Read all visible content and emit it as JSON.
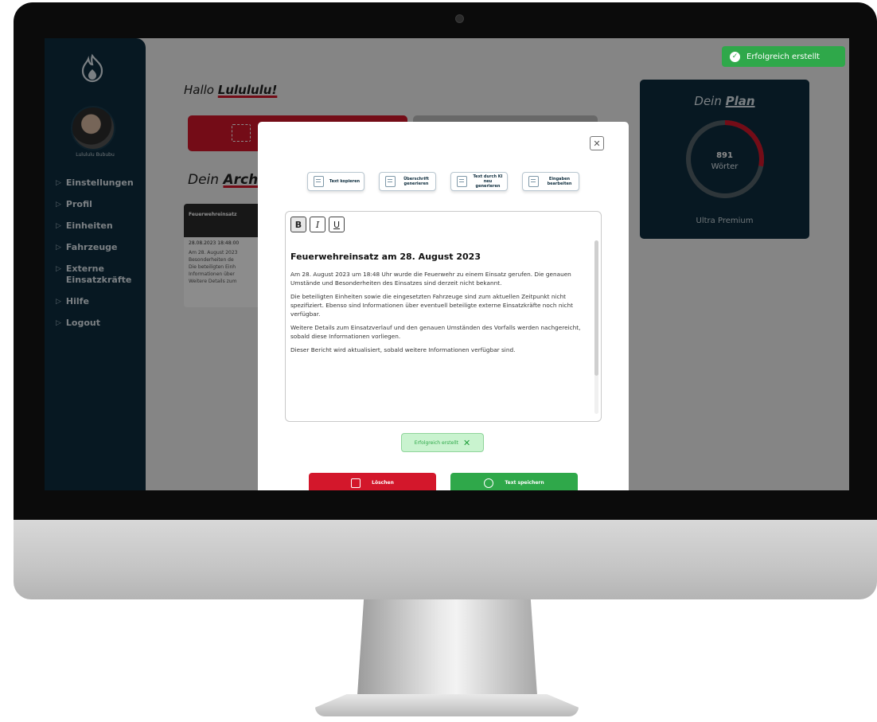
{
  "screen": {
    "greeting_prefix": "Hallo ",
    "greeting_name": "Lulululu!",
    "archive_prefix": "Dein ",
    "archive_word": "Archiv",
    "archive_card": {
      "title": "Feuerwehreinsatz",
      "date": "28.08.2023 18:48:00",
      "lines": [
        "Am 28. August 2023",
        "Besonderheiten de",
        "Die beteiligten Einh",
        "Informationen über",
        "Weitere Details zum"
      ]
    }
  },
  "sidebar": {
    "username": "Lulululu Bububu",
    "items": [
      {
        "label": "Einstellungen"
      },
      {
        "label": "Profil"
      },
      {
        "label": "Einheiten"
      },
      {
        "label": "Fahrzeuge"
      },
      {
        "label": "Externe Einsatzkräfte"
      },
      {
        "label": "Hilfe"
      },
      {
        "label": "Logout"
      }
    ]
  },
  "plan": {
    "title_prefix": "Dein ",
    "title_word": "Plan",
    "words_count": "891",
    "words_unit": "Wörter",
    "usage_fraction": 0.28,
    "tier": "Ultra Premium"
  },
  "toast": {
    "text": "Erfolgreich erstellt"
  },
  "modal": {
    "toolbar": [
      {
        "label": "Text kopieren",
        "icon": "copy-icon"
      },
      {
        "label": "Überschrift generieren",
        "icon": "heading-icon"
      },
      {
        "label": "Text durch KI neu generieren",
        "icon": "ai-regenerate-icon"
      },
      {
        "label": "Eingaben bearbeiten",
        "icon": "edit-icon"
      }
    ],
    "format": {
      "bold": "B",
      "italic": "I",
      "underline": "U"
    },
    "document": {
      "heading": "Feuerwehreinsatz am 28. August 2023",
      "paragraphs": [
        "Am 28. August 2023 um 18:48 Uhr wurde die Feuerwehr zu einem Einsatz gerufen. Die genauen Umstände und Besonderheiten des Einsatzes sind derzeit nicht bekannt.",
        "Die beteiligten Einheiten sowie die eingesetzten Fahrzeuge sind zum aktuellen Zeitpunkt nicht spezifiziert. Ebenso sind Informationen über eventuell beteiligte externe Einsatzkräfte noch nicht verfügbar.",
        "Weitere Details zum Einsatzverlauf und den genauen Umständen des Vorfalls werden nachgereicht, sobald diese Informationen vorliegen.",
        "Dieser Bericht wird aktualisiert, sobald weitere Informationen verfügbar sind."
      ]
    },
    "success_chip": "Erfolgreich erstellt",
    "delete_label": "Löschen",
    "save_label": "Text speichern"
  },
  "colors": {
    "sidebar": "#0e2d3e",
    "brand_red": "#d3172b",
    "success_green": "#2fa84a"
  }
}
